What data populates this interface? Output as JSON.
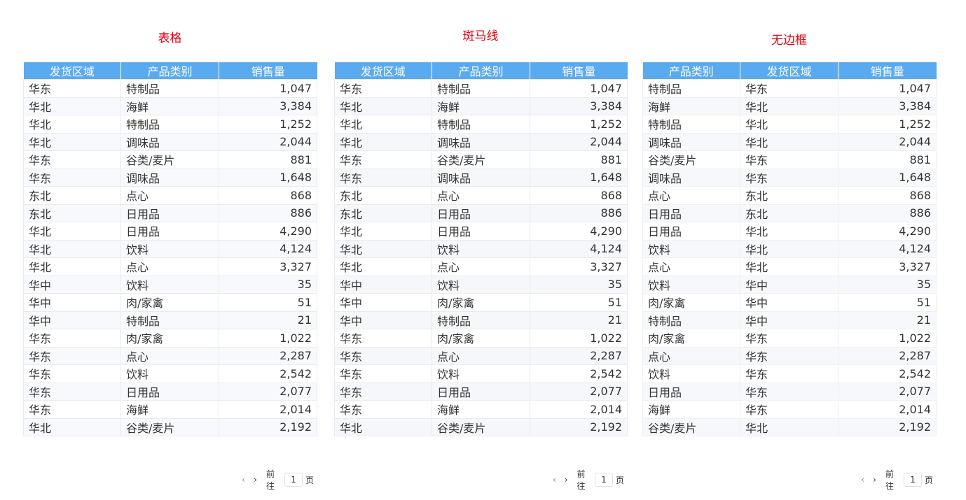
{
  "panels": [
    {
      "title": "表格",
      "columns": [
        "发货区域",
        "产品类别",
        "销售量"
      ],
      "rows": [
        [
          "华东",
          "特制品",
          "1,047"
        ],
        [
          "华北",
          "海鲜",
          "3,384"
        ],
        [
          "华北",
          "特制品",
          "1,252"
        ],
        [
          "华北",
          "调味品",
          "2,044"
        ],
        [
          "华东",
          "谷类/麦片",
          "881"
        ],
        [
          "华东",
          "调味品",
          "1,648"
        ],
        [
          "东北",
          "点心",
          "868"
        ],
        [
          "东北",
          "日用品",
          "886"
        ],
        [
          "华北",
          "日用品",
          "4,290"
        ],
        [
          "华北",
          "饮料",
          "4,124"
        ],
        [
          "华北",
          "点心",
          "3,327"
        ],
        [
          "华中",
          "饮料",
          "35"
        ],
        [
          "华中",
          "肉/家禽",
          "51"
        ],
        [
          "华中",
          "特制品",
          "21"
        ],
        [
          "华东",
          "肉/家禽",
          "1,022"
        ],
        [
          "华东",
          "点心",
          "2,287"
        ],
        [
          "华东",
          "饮料",
          "2,542"
        ],
        [
          "华东",
          "日用品",
          "2,077"
        ],
        [
          "华东",
          "海鲜",
          "2,014"
        ],
        [
          "华北",
          "谷类/麦片",
          "2,192"
        ]
      ],
      "pager": {
        "goto_label": "前往",
        "page": "1",
        "page_suffix": "页"
      }
    },
    {
      "title": "斑马线",
      "columns": [
        "发货区域",
        "产品类别",
        "销售量"
      ],
      "rows": [
        [
          "华东",
          "特制品",
          "1,047"
        ],
        [
          "华北",
          "海鲜",
          "3,384"
        ],
        [
          "华北",
          "特制品",
          "1,252"
        ],
        [
          "华北",
          "调味品",
          "2,044"
        ],
        [
          "华东",
          "谷类/麦片",
          "881"
        ],
        [
          "华东",
          "调味品",
          "1,648"
        ],
        [
          "东北",
          "点心",
          "868"
        ],
        [
          "东北",
          "日用品",
          "886"
        ],
        [
          "华北",
          "日用品",
          "4,290"
        ],
        [
          "华北",
          "饮料",
          "4,124"
        ],
        [
          "华北",
          "点心",
          "3,327"
        ],
        [
          "华中",
          "饮料",
          "35"
        ],
        [
          "华中",
          "肉/家禽",
          "51"
        ],
        [
          "华中",
          "特制品",
          "21"
        ],
        [
          "华东",
          "肉/家禽",
          "1,022"
        ],
        [
          "华东",
          "点心",
          "2,287"
        ],
        [
          "华东",
          "饮料",
          "2,542"
        ],
        [
          "华东",
          "日用品",
          "2,077"
        ],
        [
          "华东",
          "海鲜",
          "2,014"
        ],
        [
          "华北",
          "谷类/麦片",
          "2,192"
        ]
      ],
      "pager": {
        "goto_label": "前往",
        "page": "1",
        "page_suffix": "页"
      }
    },
    {
      "title": "无边框",
      "columns": [
        "产品类别",
        "发货区域",
        "销售量"
      ],
      "rows": [
        [
          "特制品",
          "华东",
          "1,047"
        ],
        [
          "海鲜",
          "华北",
          "3,384"
        ],
        [
          "特制品",
          "华北",
          "1,252"
        ],
        [
          "调味品",
          "华北",
          "2,044"
        ],
        [
          "谷类/麦片",
          "华东",
          "881"
        ],
        [
          "调味品",
          "华东",
          "1,648"
        ],
        [
          "点心",
          "东北",
          "868"
        ],
        [
          "日用品",
          "东北",
          "886"
        ],
        [
          "日用品",
          "华北",
          "4,290"
        ],
        [
          "饮料",
          "华北",
          "4,124"
        ],
        [
          "点心",
          "华北",
          "3,327"
        ],
        [
          "饮料",
          "华中",
          "35"
        ],
        [
          "肉/家禽",
          "华中",
          "51"
        ],
        [
          "特制品",
          "华中",
          "21"
        ],
        [
          "肉/家禽",
          "华东",
          "1,022"
        ],
        [
          "点心",
          "华东",
          "2,287"
        ],
        [
          "饮料",
          "华东",
          "2,542"
        ],
        [
          "日用品",
          "华东",
          "2,077"
        ],
        [
          "海鲜",
          "华东",
          "2,014"
        ],
        [
          "谷类/麦片",
          "华北",
          "2,192"
        ]
      ],
      "pager": {
        "goto_label": "前往",
        "page": "1",
        "page_suffix": "页"
      }
    }
  ],
  "colors": {
    "header_bg": "#5aaaf0",
    "title": "#e60012"
  },
  "icons": {
    "prev": "chevron-left-icon",
    "next": "chevron-right-icon"
  }
}
